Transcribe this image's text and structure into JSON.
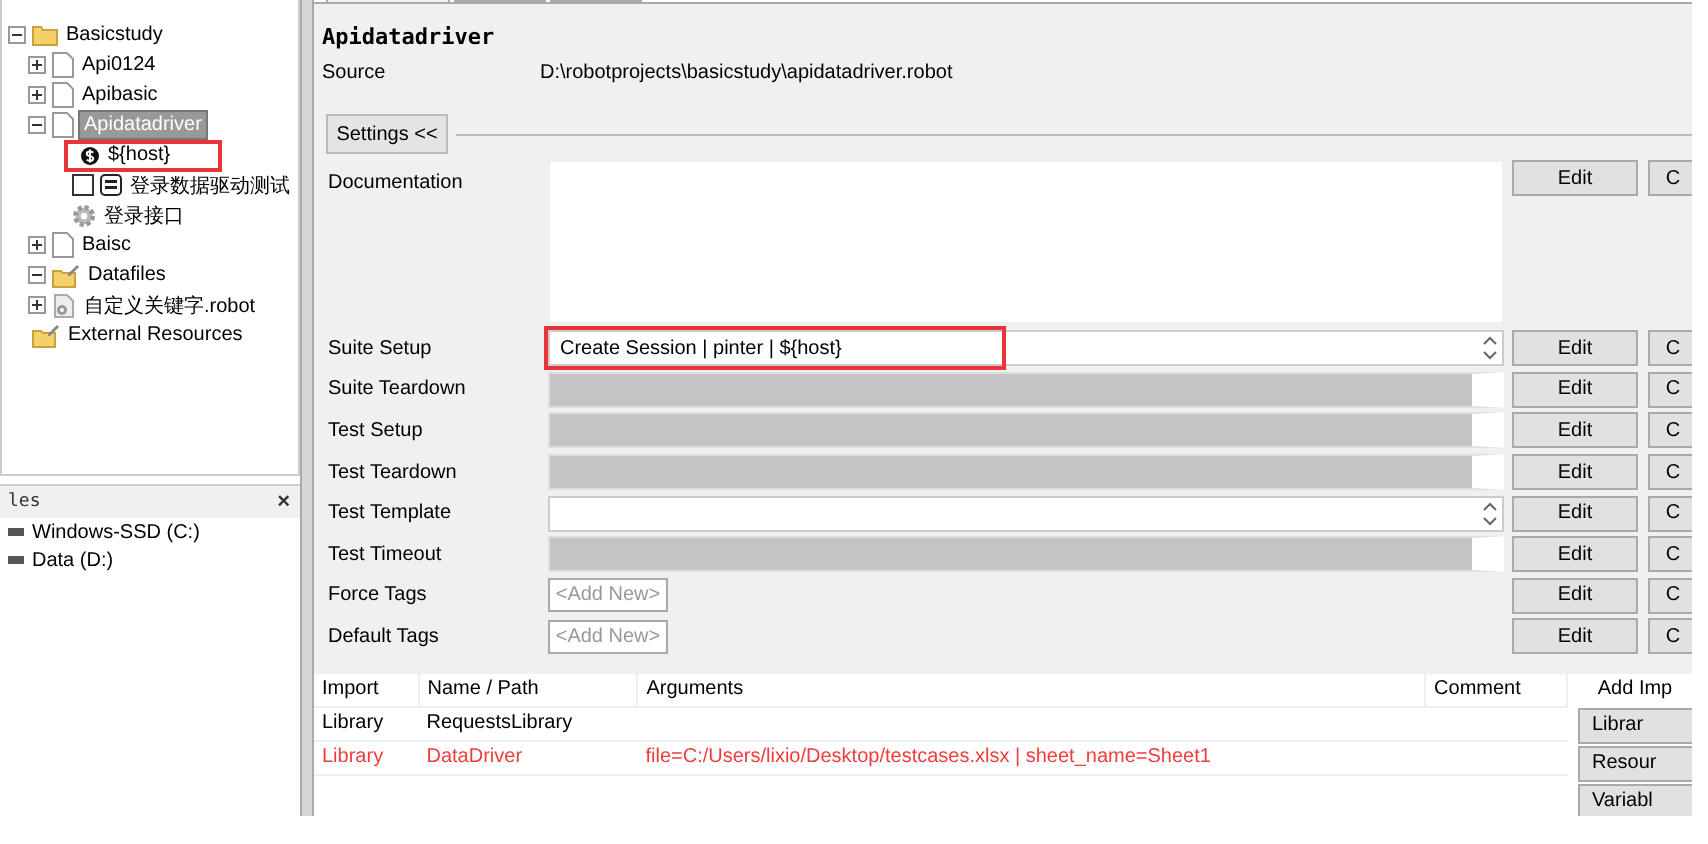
{
  "tree": [
    {
      "label": "Basicstudy",
      "kind": "folder",
      "expanded": true,
      "selected": false,
      "children": [
        {
          "label": "Api0124",
          "kind": "file",
          "expanded": false,
          "selected": false
        },
        {
          "label": "Apibasic",
          "kind": "file",
          "expanded": false,
          "selected": false
        },
        {
          "label": "Apidatadriver",
          "kind": "file",
          "expanded": true,
          "selected": true,
          "children": [
            {
              "label": "${host}",
              "kind": "variable",
              "selected": false,
              "highlighted": true
            },
            {
              "label": "登录数据驱动测试",
              "kind": "test",
              "checked": false,
              "selected": false,
              "highlighted": false
            },
            {
              "label": "登录接口",
              "kind": "keyword",
              "selected": false,
              "highlighted": false
            }
          ]
        },
        {
          "label": "Baisc",
          "kind": "file",
          "expanded": false,
          "selected": false
        },
        {
          "label": "Datafiles",
          "kind": "datafolder",
          "expanded": true,
          "selected": false
        },
        {
          "label": "自定义关键字.robot",
          "kind": "resource",
          "expanded": false,
          "selected": false
        }
      ]
    },
    {
      "label": "External Resources",
      "kind": "datafolder",
      "selected": false
    }
  ],
  "files_panel": {
    "title": "les",
    "close": "×",
    "drives": [
      {
        "label": "Windows-SSD (C:)"
      },
      {
        "label": "Data (D:)"
      }
    ]
  },
  "editor": {
    "tabs": [
      {
        "selected": true
      },
      {
        "selected": false
      },
      {
        "selected": false
      }
    ],
    "title": "Apidatadriver",
    "source_label": "Source",
    "source": "D:\\robotprojects\\basicstudy\\apidatadriver.robot",
    "settings_toggle": "Settings <<",
    "settings": [
      {
        "label": "Documentation",
        "kind": "textarea",
        "buttons": [
          "Edit",
          "C"
        ]
      },
      {
        "label": "Suite Setup",
        "kind": "field",
        "value": "Create Session | pinter | ${host}",
        "disabled": false,
        "highlighted": true,
        "buttons": [
          "Edit",
          "C"
        ]
      },
      {
        "label": "Suite Teardown",
        "kind": "field",
        "disabled": true,
        "highlighted": false,
        "buttons": [
          "Edit",
          "C"
        ]
      },
      {
        "label": "Test Setup",
        "kind": "field",
        "disabled": true,
        "highlighted": false,
        "buttons": [
          "Edit",
          "C"
        ]
      },
      {
        "label": "Test Teardown",
        "kind": "field",
        "disabled": true,
        "highlighted": false,
        "buttons": [
          "Edit",
          "C"
        ]
      },
      {
        "label": "Test Template",
        "kind": "field",
        "disabled": false,
        "highlighted": false,
        "buttons": [
          "Edit",
          "C"
        ]
      },
      {
        "label": "Test Timeout",
        "kind": "field",
        "disabled": true,
        "highlighted": false,
        "buttons": [
          "Edit",
          "C"
        ]
      },
      {
        "label": "Force Tags",
        "kind": "tags",
        "add": "<Add New>",
        "buttons": [
          "Edit",
          "C"
        ]
      },
      {
        "label": "Default Tags",
        "kind": "tags",
        "add": "<Add New>",
        "buttons": [
          "Edit",
          "C"
        ]
      }
    ],
    "imports": {
      "columns": [
        "Import",
        "Name / Path",
        "Arguments",
        "Comment"
      ],
      "rows": [
        {
          "import": "Library",
          "name": "RequestsLibrary",
          "error": false
        },
        {
          "import": "Library",
          "name": "DataDriver",
          "arguments": "file=C:/Users/lixio/Desktop/testcases.xlsx | sheet_name=Sheet1",
          "error": true
        }
      ]
    },
    "import_actions": {
      "title": "Add Imp",
      "buttons": [
        "Librar",
        "Resour",
        "Variabl"
      ]
    }
  }
}
